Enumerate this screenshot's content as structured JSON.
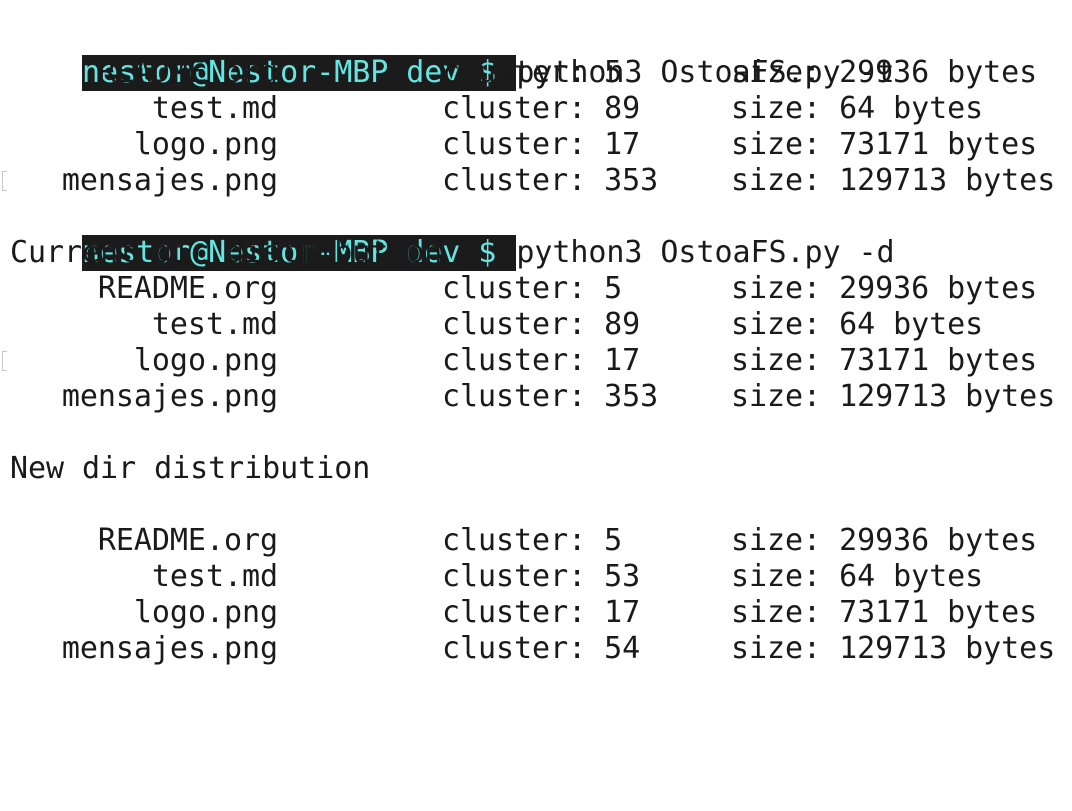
{
  "prompt": "nestor@Nestor-MBP dev $ ",
  "commands": [
    "python3 OstoaFS.py -t",
    "python3 OstoaFS.py -d"
  ],
  "headings": {
    "current": "Current dir distribution",
    "new": "New dir distribution"
  },
  "listing_t": [
    {
      "name": "README.org",
      "cluster": "cluster: 5",
      "size": "size: 29936 bytes"
    },
    {
      "name": "test.md",
      "cluster": "cluster: 89",
      "size": "size: 64 bytes"
    },
    {
      "name": "logo.png",
      "cluster": "cluster: 17",
      "size": "size: 73171 bytes"
    },
    {
      "name": "mensajes.png",
      "cluster": "cluster: 353",
      "size": "size: 129713 bytes"
    }
  ],
  "listing_current": [
    {
      "name": "README.org",
      "cluster": "cluster: 5",
      "size": "size: 29936 bytes"
    },
    {
      "name": "test.md",
      "cluster": "cluster: 89",
      "size": "size: 64 bytes"
    },
    {
      "name": "logo.png",
      "cluster": "cluster: 17",
      "size": "size: 73171 bytes"
    },
    {
      "name": "mensajes.png",
      "cluster": "cluster: 353",
      "size": "size: 129713 bytes"
    }
  ],
  "listing_new": [
    {
      "name": "README.org",
      "cluster": "cluster: 5",
      "size": "size: 29936 bytes"
    },
    {
      "name": "test.md",
      "cluster": "cluster: 53",
      "size": "size: 64 bytes"
    },
    {
      "name": "logo.png",
      "cluster": "cluster: 17",
      "size": "size: 73171 bytes"
    },
    {
      "name": "mensajes.png",
      "cluster": "cluster: 54",
      "size": "size: 129713 bytes"
    }
  ],
  "colors": {
    "prompt_fg": "#63e6e2",
    "prompt_bg": "#1b1b1b",
    "text": "#1a1a1a",
    "background": "#ffffff"
  }
}
